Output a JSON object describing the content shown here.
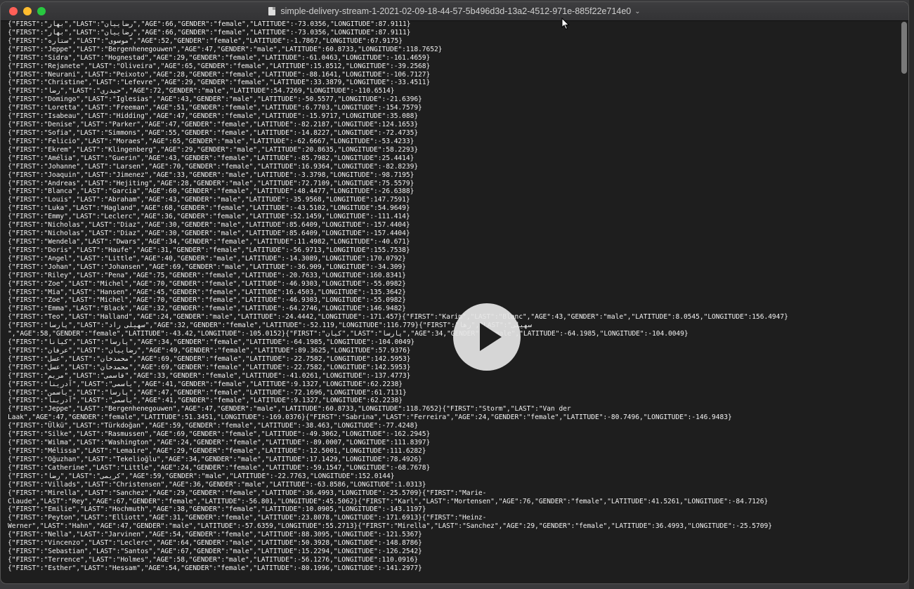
{
  "window": {
    "title": "simple-delivery-stream-1-2021-02-09-18-44-57-5b496d3d-13a2-4512-971e-885f22e714e0",
    "title_chevron": "⌄"
  },
  "icons": {
    "document": "document-icon",
    "chevron": "chevron-down-icon",
    "play": "play-icon",
    "cursor": "mouse-pointer-icon"
  },
  "lines": [
    "{\"FIRST\":\"بهار\",\"LAST\":\"رضاییان\",\"AGE\":66,\"GENDER\":\"female\",\"LATITUDE\":-73.0356,\"LONGITUDE\":87.9111}",
    "{\"FIRST\":\"بهار\",\"LAST\":\"رضاییان\",\"AGE\":66,\"GENDER\":\"female\",\"LATITUDE\":-73.0356,\"LONGITUDE\":87.9111}",
    "{\"FIRST\":\"ستاره\",\"LAST\":\"موسوی\",\"AGE\":52,\"GENDER\":\"female\",\"LATITUDE\":-1.7867,\"LONGITUDE\":67.9175}",
    "{\"FIRST\":\"Jeppe\",\"LAST\":\"Bergenhenegouwen\",\"AGE\":47,\"GENDER\":\"male\",\"LATITUDE\":60.8733,\"LONGITUDE\":118.7652}",
    "{\"FIRST\":\"Sidra\",\"LAST\":\"Hognestad\",\"AGE\":29,\"GENDER\":\"female\",\"LATITUDE\":-61.0463,\"LONGITUDE\":-161.4659}",
    "{\"FIRST\":\"Rejanete\",\"LAST\":\"Oliveira\",\"AGE\":65,\"GENDER\":\"female\",\"LATITUDE\":15.8512,\"LONGITUDE\":-39.2568}",
    "{\"FIRST\":\"Neurani\",\"LAST\":\"Peixoto\",\"AGE\":28,\"GENDER\":\"female\",\"LATITUDE\":-88.1641,\"LONGITUDE\":-106.7127}",
    "{\"FIRST\":\"Christine\",\"LAST\":\"Lefevre\",\"AGE\":29,\"GENDER\":\"female\",\"LATITUDE\":33.3879,\"LONGITUDE\":-33.4511}",
    "{\"FIRST\":\"رضا\",\"LAST\":\"حیدری\",\"AGE\":72,\"GENDER\":\"male\",\"LATITUDE\":54.7269,\"LONGITUDE\":-110.6514}",
    "{\"FIRST\":\"Domingo\",\"LAST\":\"Iglesias\",\"AGE\":43,\"GENDER\":\"male\",\"LATITUDE\":-50.5577,\"LONGITUDE\":-21.6396}",
    "{\"FIRST\":\"Loretta\",\"LAST\":\"Freeman\",\"AGE\":51,\"GENDER\":\"female\",\"LATITUDE\":6.7703,\"LONGITUDE\":-154.7579}",
    "{\"FIRST\":\"Isabeau\",\"LAST\":\"Hidding\",\"AGE\":47,\"GENDER\":\"female\",\"LATITUDE\":-15.9717,\"LONGITUDE\":35.088}",
    "{\"FIRST\":\"Denise\",\"LAST\":\"Parker\",\"AGE\":47,\"GENDER\":\"female\",\"LATITUDE\":-82.2187,\"LONGITUDE\":124.1653}",
    "{\"FIRST\":\"Sofia\",\"LAST\":\"Simmons\",\"AGE\":55,\"GENDER\":\"female\",\"LATITUDE\":-14.8227,\"LONGITUDE\":-72.4735}",
    "{\"FIRST\":\"Felicio\",\"LAST\":\"Moraes\",\"AGE\":65,\"GENDER\":\"male\",\"LATITUDE\":-62.6667,\"LONGITUDE\":-53.4233}",
    "{\"FIRST\":\"Ekrem\",\"LAST\":\"Klingenberg\",\"AGE\":29,\"GENDER\":\"male\",\"LATITUDE\":20.8635,\"LONGITUDE\":58.2293}",
    "{\"FIRST\":\"Amélia\",\"LAST\":\"Guerin\",\"AGE\":43,\"GENDER\":\"female\",\"LATITUDE\":-85.7982,\"LONGITUDE\":25.4414}",
    "{\"FIRST\":\"Johanne\",\"LAST\":\"Larsen\",\"AGE\":70,\"GENDER\":\"female\",\"LATITUDE\":16.9364,\"LONGITUDE\":-82.8239}",
    "{\"FIRST\":\"Joaquin\",\"LAST\":\"Jimenez\",\"AGE\":33,\"GENDER\":\"male\",\"LATITUDE\":-3.3798,\"LONGITUDE\":-98.7195}",
    "{\"FIRST\":\"Andreas\",\"LAST\":\"Hejiting\",\"AGE\":28,\"GENDER\":\"male\",\"LATITUDE\":72.7109,\"LONGITUDE\":75.5579}",
    "{\"FIRST\":\"Blanca\",\"LAST\":\"Garcia\",\"AGE\":60,\"GENDER\":\"female\",\"LATITUDE\":48.4477,\"LONGITUDE\":-26.6388}",
    "{\"FIRST\":\"Louis\",\"LAST\":\"Abraham\",\"AGE\":43,\"GENDER\":\"male\",\"LATITUDE\":-35.9568,\"LONGITUDE\":147.7591}",
    "{\"FIRST\":\"Luka\",\"LAST\":\"Hagland\",\"AGE\":68,\"GENDER\":\"female\",\"LATITUDE\":-43.5102,\"LONGITUDE\":54.9649}",
    "{\"FIRST\":\"Emmy\",\"LAST\":\"Leclerc\",\"AGE\":36,\"GENDER\":\"female\",\"LATITUDE\":52.1459,\"LONGITUDE\":-111.414}",
    "{\"FIRST\":\"Nicholas\",\"LAST\":\"Diaz\",\"AGE\":30,\"GENDER\":\"male\",\"LATITUDE\":85.6409,\"LONGITUDE\":-157.4404}",
    "{\"FIRST\":\"Nicholas\",\"LAST\":\"Diaz\",\"AGE\":30,\"GENDER\":\"male\",\"LATITUDE\":85.6409,\"LONGITUDE\":-157.4404}",
    "{\"FIRST\":\"Wendela\",\"LAST\":\"Dwars\",\"AGE\":34,\"GENDER\":\"female\",\"LATITUDE\":11.4982,\"LONGITUDE\":-40.671}",
    "{\"FIRST\":\"Doris\",\"LAST\":\"Haufe\",\"AGE\":31,\"GENDER\":\"female\",\"LATITUDE\":-56.9713,\"LONGITUDE\":155.7538}",
    "{\"FIRST\":\"Angel\",\"LAST\":\"Little\",\"AGE\":40,\"GENDER\":\"male\",\"LATITUDE\":-14.3089,\"LONGITUDE\":170.0792}",
    "{\"FIRST\":\"Johan\",\"LAST\":\"Johansen\",\"AGE\":69,\"GENDER\":\"male\",\"LATITUDE\":-36.909,\"LONGITUDE\":-34.309}",
    "{\"FIRST\":\"Riley\",\"LAST\":\"Pena\",\"AGE\":75,\"GENDER\":\"female\",\"LATITUDE\":-20.7633,\"LONGITUDE\":160.8341}",
    "{\"FIRST\":\"Zoe\",\"LAST\":\"Michel\",\"AGE\":70,\"GENDER\":\"female\",\"LATITUDE\":-46.9303,\"LONGITUDE\":-55.0982}",
    "{\"FIRST\":\"Mia\",\"LAST\":\"Hansen\",\"AGE\":45,\"GENDER\":\"female\",\"LATITUDE\":16.4503,\"LONGITUDE\":-135.3642}",
    "{\"FIRST\":\"Zoe\",\"LAST\":\"Michel\",\"AGE\":70,\"GENDER\":\"female\",\"LATITUDE\":-46.9303,\"LONGITUDE\":-55.0982}",
    "{\"FIRST\":\"Emma\",\"LAST\":\"Black\",\"AGE\":32,\"GENDER\":\"female\",\"LATITUDE\":-64.2746,\"LONGITUDE\":146.9482}",
    "{\"FIRST\":\"Teo\",\"LAST\":\"Halland\",\"AGE\":24,\"GENDER\":\"male\",\"LATITUDE\":-24.4442,\"LONGITUDE\":-171.457}{\"FIRST\":\"Karim\",\"LAST\":\"Blanc\",\"AGE\":43,\"GENDER\":\"male\",\"LATITUDE\":8.0545,\"LONGITUDE\":156.4947}",
    "{\"FIRST\":\"پارسا\",\"LAST\":\"سهیلی راد\",\"AGE\":32,\"GENDER\":\"female\",\"LATITUDE\":-52.119,\"LONGITUDE\":116.779}{\"FIRST\":\"رها\",\"LAST\":\"سهیلی",
    "\",\"AGE\":58,\"GENDER\":\"female\",\"LATITUDE\":-43.42,\"LONGITUDE\":-105.0152}{\"FIRST\":\"کیان\",\"LAST\":\"پارسا\",\"AGE\":34,\"GENDER\":\"female\",\"LATITUDE\":-64.1985,\"LONGITUDE\":-104.0049}",
    "{\"FIRST\":\"کیانا\",\"LAST\":\"پارسا\",\"AGE\":34,\"GENDER\":\"female\",\"LATITUDE\":-64.1985,\"LONGITUDE\":-104.0049}",
    "{\"FIRST\":\"عرفان\",\"LAST\":\"رضاییان\",\"AGE\":49,\"GENDER\":\"female\",\"LATITUDE\":89.3625,\"LONGITUDE\":57.9376}",
    "{\"FIRST\":\"عسل\",\"LAST\":\"محمدخان\",\"AGE\":69,\"GENDER\":\"female\",\"LATITUDE\":-22.7582,\"LONGITUDE\":142.5953}",
    "{\"FIRST\":\"عسل\",\"LAST\":\"محمدخان\",\"AGE\":69,\"GENDER\":\"female\",\"LATITUDE\":-22.7582,\"LONGITUDE\":142.5953}",
    "{\"FIRST\":\"مریم\",\"LAST\":\"قاسمی\",\"AGE\":33,\"GENDER\":\"female\",\"LATITUDE\":-41.0261,\"LONGITUDE\":-137.4773}",
    "{\"FIRST\":\"آدرینا\",\"LAST\":\"یاسمی\",\"AGE\":41,\"GENDER\":\"female\",\"LATITUDE\":9.1327,\"LONGITUDE\":62.2238}",
    "{\"FIRST\":\"یاسمن\",\"LAST\":\"پارسا\",\"AGE\":47,\"GENDER\":\"female\",\"LATITUDE\":-72.1696,\"LONGITUDE\":61.7131}",
    "{\"FIRST\":\"آدرینا\",\"LAST\":\"یاسمی\",\"AGE\":41,\"GENDER\":\"female\",\"LATITUDE\":9.1327,\"LONGITUDE\":62.2238}",
    "{\"FIRST\":\"Jeppe\",\"LAST\":\"Bergenhenegouwen\",\"AGE\":47,\"GENDER\":\"male\",\"LATITUDE\":60.8733,\"LONGITUDE\":118.7652}{\"FIRST\":\"Storm\",\"LAST\":\"Van der",
    "Laak\",\"AGE\":47,\"GENDER\":\"female\",\"LATITUDE\":51.3451,\"LONGITUDE\":-169.0376}{\"FIRST\":\"Sabrina\",\"LAST\":\"Ferreira\",\"AGE\":24,\"GENDER\":\"female\",\"LATITUDE\":-80.7496,\"LONGITUDE\":-146.9483}",
    "{\"FIRST\":\"Ülkü\",\"LAST\":\"Türkdoğan\",\"AGE\":59,\"GENDER\":\"female\",\"LATITUDE\":-38.463,\"LONGITUDE\":-77.4248}",
    "{\"FIRST\":\"Silke\",\"LAST\":\"Rasmussen\",\"AGE\":69,\"GENDER\":\"female\",\"LATITUDE\":-49.3062,\"LONGITUDE\":-162.2945}",
    "{\"FIRST\":\"Wilma\",\"LAST\":\"Washington\",\"AGE\":24,\"GENDER\":\"female\",\"LATITUDE\":-89.0007,\"LONGITUDE\":111.8397}",
    "{\"FIRST\":\"Mélissa\",\"LAST\":\"Lemaire\",\"AGE\":29,\"GENDER\":\"female\",\"LATITUDE\":-12.5001,\"LONGITUDE\":111.6282}",
    "{\"FIRST\":\"Oğuzhan\",\"LAST\":\"Tekelioğlu\",\"AGE\":34,\"GENDER\":\"male\",\"LATITUDE\":17.1429,\"LONGITUDE\":78.4926}",
    "{\"FIRST\":\"Catherine\",\"LAST\":\"Little\",\"AGE\":24,\"GENDER\":\"female\",\"LATITUDE\":-59.1547,\"LONGITUDE\":-68.7678}",
    "{\"FIRST\":\"رضا\",\"LAST\":\"کریمی\",\"AGE\":59,\"GENDER\":\"male\",\"LATITUDE\":-22.7763,\"LONGITUDE\":152.0144}",
    "{\"FIRST\":\"Villads\",\"LAST\":\"Christensen\",\"AGE\":36,\"GENDER\":\"male\",\"LATITUDE\":-63.8586,\"LONGITUDE\":1.0313}",
    "{\"FIRST\":\"Mirella\",\"LAST\":\"Sanchez\",\"AGE\":29,\"GENDER\":\"female\",\"LATITUDE\":36.4993,\"LONGITUDE\":-25.5709}{\"FIRST\":\"Marie-",
    "Claude\",\"LAST\":\"Rey\",\"AGE\":67,\"GENDER\":\"female\",\"LATITUDE\":-56.801,\"LONGITUDE\":45.5062}{\"FIRST\":\"Karl\",\"LAST\":\"Mortensen\",\"AGE\":76,\"GENDER\":\"female\",\"LATITUDE\":41.5261,\"LONGITUDE\":-84.7126}",
    "{\"FIRST\":\"Emilie\",\"LAST\":\"Hochmuth\",\"AGE\":38,\"GENDER\":\"female\",\"LATITUDE\":10.0905,\"LONGITUDE\":-143.1197}",
    "{\"FIRST\":\"Peyton\",\"LAST\":\"Elliott\",\"AGE\":31,\"GENDER\":\"female\",\"LATITUDE\":23.8078,\"LONGITUDE\":-171.6913}{\"FIRST\":\"Heinz-",
    "Werner\",\"LAST\":\"Hahn\",\"AGE\":47,\"GENDER\":\"male\",\"LATITUDE\":-57.6359,\"LONGITUDE\":55.2713}{\"FIRST\":\"Mirella\",\"LAST\":\"Sanchez\",\"AGE\":29,\"GENDER\":\"female\",\"LATITUDE\":36.4993,\"LONGITUDE\":-25.5709}",
    "{\"FIRST\":\"Nella\",\"LAST\":\"Jarvinen\",\"AGE\":54,\"GENDER\":\"female\",\"LATITUDE\":88.3095,\"LONGITUDE\":-121.5367}",
    "{\"FIRST\":\"Vincenzo\",\"LAST\":\"Leclerc\",\"AGE\":64,\"GENDER\":\"male\",\"LATITUDE\":50.3928,\"LONGITUDE\":-148.8786}",
    "{\"FIRST\":\"Sebastian\",\"LAST\":\"Santos\",\"AGE\":67,\"GENDER\":\"male\",\"LATITUDE\":15.2294,\"LONGITUDE\":-126.2542}",
    "{\"FIRST\":\"Terrence\",\"LAST\":\"Holmes\",\"AGE\":58,\"GENDER\":\"male\",\"LATITUDE\":-56.1276,\"LONGITUDE\":110.0916}",
    "{\"FIRST\":\"Esther\",\"LAST\":\"Hessam\",\"AGE\":54,\"GENDER\":\"female\",\"LATITUDE\":-80.1996,\"LONGITUDE\":-141.2977}"
  ]
}
